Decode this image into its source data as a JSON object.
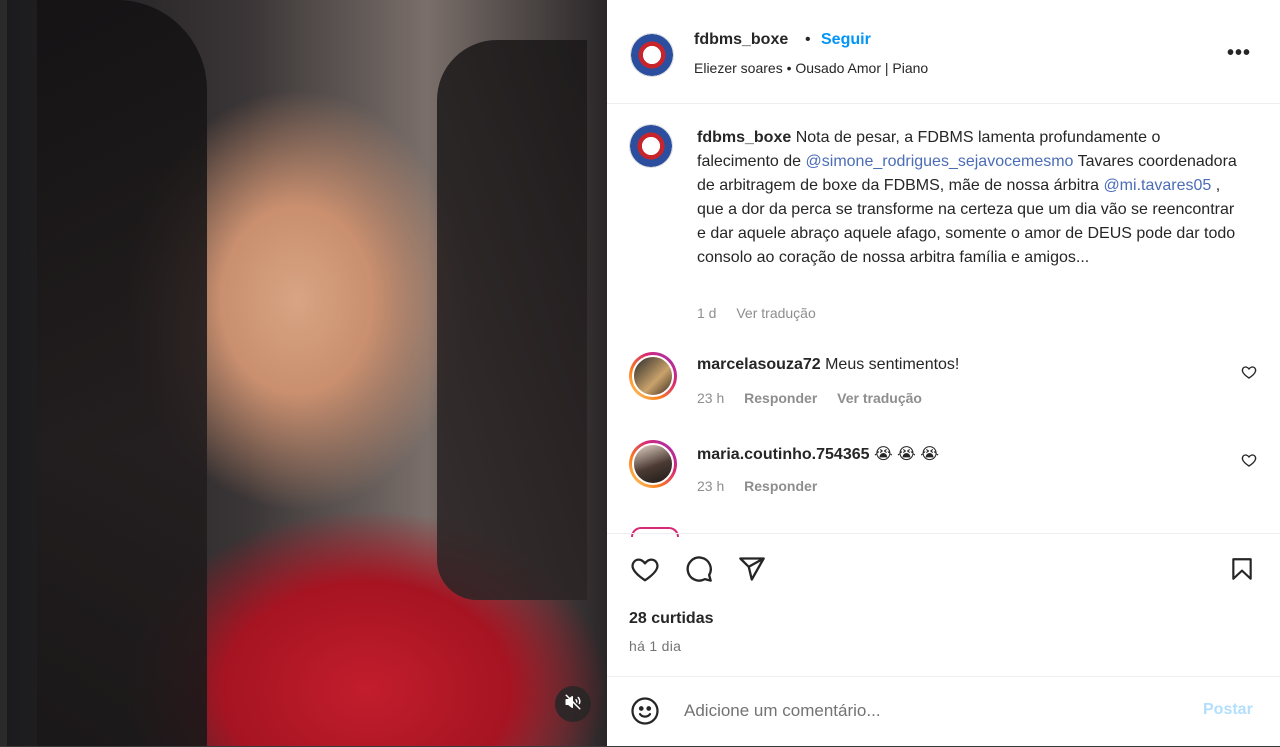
{
  "post": {
    "account": "fdbms_boxe",
    "follow_label": "Seguir",
    "separator": "•",
    "audio": "Eliezer soares • Ousado Amor | Piano",
    "more_label": "•••"
  },
  "caption": {
    "username": "fdbms_boxe",
    "part1": " Nota de pesar, a FDBMS lamenta profundamente o falecimento de ",
    "mention1": "@simone_rodrigues_sejavocemesmo",
    "part2": " Tavares coordenadora de arbitragem de boxe da FDBMS, mãe de nossa árbitra ",
    "mention2": "@mi.tavares05",
    "part3": " , que a dor da perca se transforme na certeza que um dia vão se reencontrar e dar aquele abraço aquele afago, somente o amor de DEUS pode dar todo consolo ao coração de nossa arbitra família e amigos...",
    "time": "1 d",
    "translate": "Ver tradução"
  },
  "comments": [
    {
      "username": "marcelasouza72",
      "text": "Meus sentimentos!",
      "time": "23 h",
      "reply": "Responder",
      "translate": "Ver tradução"
    },
    {
      "username": "maria.coutinho.754365",
      "text": "😭 😭 😭",
      "time": "23 h",
      "reply": "Responder"
    }
  ],
  "stats": {
    "likes": "28 curtidas",
    "when": "há 1 dia"
  },
  "composer": {
    "placeholder": "Adicione um comentário...",
    "post_label": "Postar"
  },
  "icons": {
    "like": "heart-icon",
    "comment": "comment-icon",
    "share": "paper-plane-icon",
    "save": "bookmark-icon",
    "emoji": "emoji-icon",
    "mute": "speaker-muted-icon"
  },
  "colors": {
    "link": "#0095f6",
    "mention": "#4b6cb7",
    "muted": "#737373",
    "post_disabled": "#b2dffc"
  }
}
